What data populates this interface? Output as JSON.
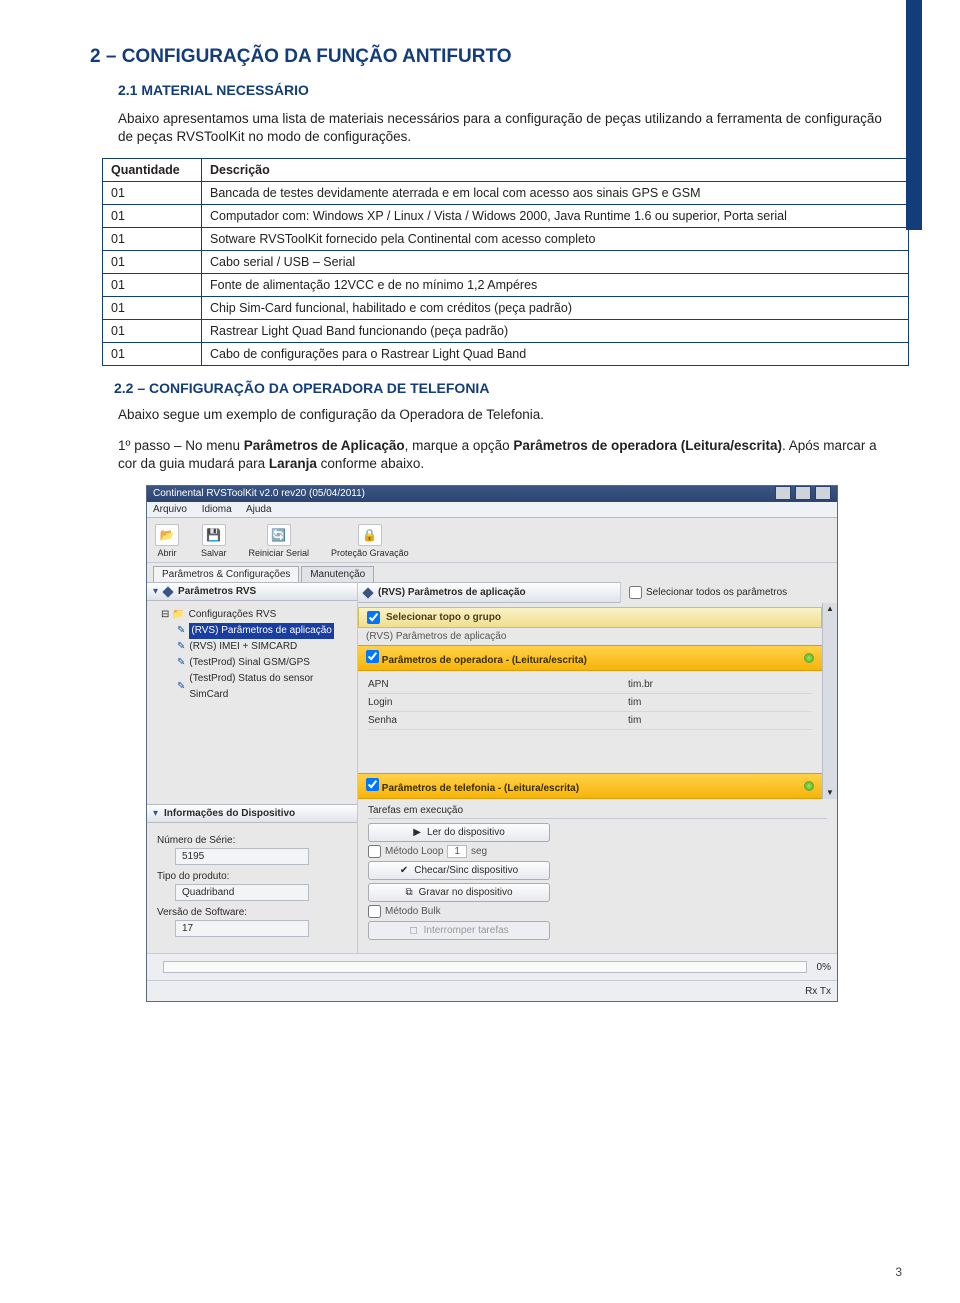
{
  "headings": {
    "h1": "2 – CONFIGURAÇÃO DA FUNÇÃO ANTIFURTO",
    "s21": "2.1 MATERIAL NECESSÁRIO",
    "s22": "2.2 – CONFIGURAÇÃO DA OPERADORA DE TELEFONIA"
  },
  "paragraphs": {
    "p21": "Abaixo apresentamos uma lista de materiais necessários para a configuração de peças utilizando a ferramenta de configuração de peças RVSToolKit no modo de configurações.",
    "p22a": "Abaixo segue um exemplo de configuração da Operadora de Telefonia.",
    "p22b_pre": "1º passo – No menu ",
    "p22b_b1": "Parâmetros de Aplicação",
    "p22b_mid": ", marque a opção ",
    "p22b_b2": "Parâmetros de operadora (Leitura/escrita)",
    "p22b_post": ". Após marcar a cor da guia mudará para ",
    "p22b_b3": "Laranja",
    "p22b_end": " conforme abaixo."
  },
  "table": {
    "head_q": "Quantidade",
    "head_d": "Descrição",
    "rows": [
      {
        "q": "01",
        "d": "Bancada de testes devidamente aterrada e em local com acesso aos sinais GPS e GSM"
      },
      {
        "q": "01",
        "d": "Computador com: Windows XP / Linux / Vista / Widows 2000, Java Runtime 1.6 ou superior, Porta serial"
      },
      {
        "q": "01",
        "d": "Sotware RVSToolKit fornecido pela Continental com acesso completo"
      },
      {
        "q": "01",
        "d": "Cabo serial / USB – Serial"
      },
      {
        "q": "01",
        "d": "Fonte de alimentação 12VCC e de no mínimo 1,2 Ampéres"
      },
      {
        "q": "01",
        "d": "Chip Sim-Card funcional, habilitado e com créditos (peça padrão)"
      },
      {
        "q": "01",
        "d": "Rastrear Light Quad Band funcionando (peça padrão)"
      },
      {
        "q": "01",
        "d": "Cabo de configurações para o Rastrear Light Quad Band"
      }
    ]
  },
  "app": {
    "title": "Continental RVSToolKit v2.0 rev20 (05/04/2011)",
    "menus": [
      "Arquivo",
      "Idioma",
      "Ajuda"
    ],
    "toolbar": [
      {
        "icon": "open-icon",
        "label": "Abrir"
      },
      {
        "icon": "save-icon",
        "label": "Salvar"
      },
      {
        "icon": "restart-icon",
        "label": "Reiniciar Serial"
      },
      {
        "icon": "lock-icon",
        "label": "Proteção Gravação"
      }
    ],
    "tabs": [
      "Parâmetros & Configurações",
      "Manutenção"
    ],
    "leftTitle": "Parâmetros RVS",
    "tree": {
      "root": "Configurações RVS",
      "items": [
        "(RVS) Parâmetros de aplicação",
        "(RVS) IMEI + SIMCARD",
        "(TestProd) Sinal GSM/GPS",
        "(TestProd) Status do sensor SimCard"
      ],
      "selectedIndex": 0
    },
    "rightTitle": "(RVS) Parâmetros de aplicação",
    "selectAll": "Selecionar todos os parâmetros",
    "groupSel": "Selecionar topo o grupo",
    "groupSub": "(RVS) Parâmetros de aplicação",
    "yellow1": "Parâmetros de operadora - (Leitura/escrita)",
    "fields": [
      {
        "label": "APN",
        "value": "tim.br"
      },
      {
        "label": "Login",
        "value": "tim"
      },
      {
        "label": "Senha",
        "value": "tim"
      }
    ],
    "yellow2": "Parâmetros de telefonia - (Leitura/escrita)",
    "devInfoTitle": "Informações do Dispositivo",
    "devInfo": {
      "serialLabel": "Número de Série:",
      "serial": "5195",
      "typeLabel": "Tipo do produto:",
      "type": "Quadriband",
      "swLabel": "Versão de Software:",
      "sw": "17"
    },
    "tasksTitle": "Tarefas em execução",
    "btns": {
      "read": "Ler do dispositivo",
      "loop": "Método Loop",
      "loopSeg": "seg",
      "loopVal": "1",
      "check": "Checar/Sinc dispositivo",
      "write": "Gravar no dispositivo",
      "bulk": "Método Bulk",
      "stop": "Interromper tarefas"
    },
    "progress": "0%",
    "rxtx": "Rx Tx"
  },
  "pageNumber": "3"
}
